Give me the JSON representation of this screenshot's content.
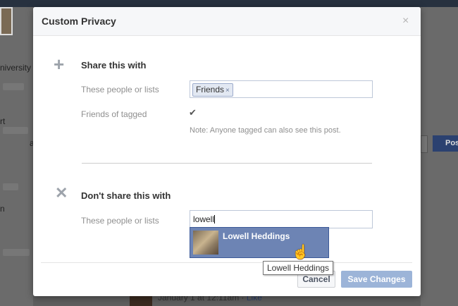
{
  "background": {
    "left_texts": [
      "niversity",
      "rt",
      "a",
      "n"
    ],
    "post_button_label": "Pos",
    "timestamp_text": "January 1 at 12:11am · ",
    "timestamp_link": "Like"
  },
  "dialog": {
    "title": "Custom Privacy",
    "close_glyph": "×",
    "share_section": {
      "title": "Share this with",
      "people_label": "These people or lists",
      "token_label": "Friends",
      "token_remove_glyph": "×",
      "friends_of_tagged_label": "Friends of tagged",
      "friends_of_tagged_checked": true,
      "note": "Note: Anyone tagged can also see this post."
    },
    "dont_share_section": {
      "title": "Don't share this with",
      "people_label": "These people or lists",
      "input_value": "lowell",
      "suggestion_name": "Lowell Heddings",
      "tooltip": "Lowell Heddings"
    },
    "buttons": {
      "cancel": "Cancel",
      "save": "Save Changes"
    }
  },
  "colors": {
    "suggestion_highlight": "#6d84b4",
    "save_button_disabled": "#9cb4d8",
    "token_bg": "#e2e8f2"
  }
}
